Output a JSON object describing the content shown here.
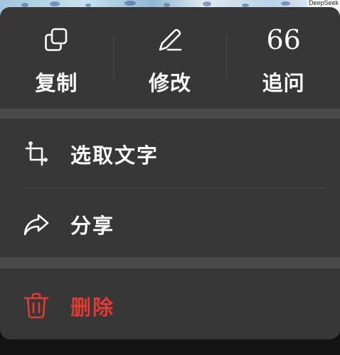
{
  "background": {
    "watermark": "DeepSeek"
  },
  "menu": {
    "top_actions": [
      {
        "id": "copy",
        "label": "复制",
        "icon": "copy-icon"
      },
      {
        "id": "edit",
        "label": "修改",
        "icon": "pencil-icon"
      },
      {
        "id": "follow_up",
        "label": "追问",
        "icon": "quote-icon",
        "glyph": "66"
      }
    ],
    "items": [
      {
        "id": "select_text",
        "label": "选取文字",
        "icon": "crop-icon"
      },
      {
        "id": "share",
        "label": "分享",
        "icon": "share-arrow-icon"
      }
    ],
    "danger_item": {
      "id": "delete",
      "label": "删除",
      "icon": "trash-icon"
    }
  },
  "colors": {
    "menu_bg": "#373737",
    "band": "#4a4a4a",
    "text": "#ffffff",
    "danger": "#e23b33"
  }
}
